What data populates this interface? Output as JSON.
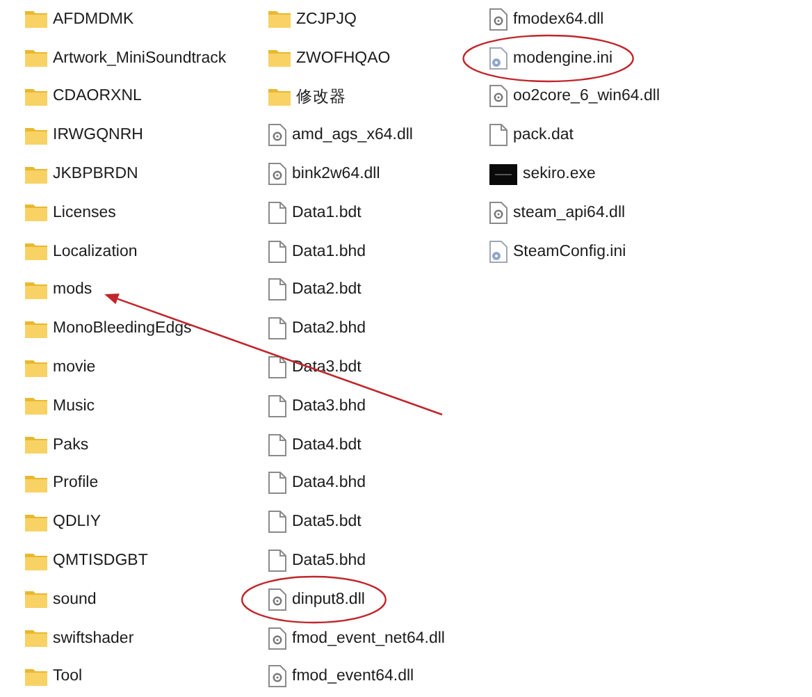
{
  "files": [
    {
      "name": "AFDMDMK",
      "kind": "folder",
      "circled": false,
      "arrowed": false
    },
    {
      "name": "Artwork_MiniSoundtrack",
      "kind": "folder",
      "circled": false,
      "arrowed": false
    },
    {
      "name": "CDAORXNL",
      "kind": "folder",
      "circled": false,
      "arrowed": false
    },
    {
      "name": "IRWGQNRH",
      "kind": "folder",
      "circled": false,
      "arrowed": false
    },
    {
      "name": "JKBPBRDN",
      "kind": "folder",
      "circled": false,
      "arrowed": false
    },
    {
      "name": "Licenses",
      "kind": "folder",
      "circled": false,
      "arrowed": false
    },
    {
      "name": "Localization",
      "kind": "folder",
      "circled": false,
      "arrowed": false
    },
    {
      "name": "mods",
      "kind": "folder",
      "circled": false,
      "arrowed": true
    },
    {
      "name": "MonoBleedingEdgs",
      "kind": "folder",
      "circled": false,
      "arrowed": false
    },
    {
      "name": "movie",
      "kind": "folder",
      "circled": false,
      "arrowed": false
    },
    {
      "name": "Music",
      "kind": "folder",
      "circled": false,
      "arrowed": false
    },
    {
      "name": "Paks",
      "kind": "folder",
      "circled": false,
      "arrowed": false
    },
    {
      "name": "Profile",
      "kind": "folder",
      "circled": false,
      "arrowed": false
    },
    {
      "name": "QDLIY",
      "kind": "folder",
      "circled": false,
      "arrowed": false
    },
    {
      "name": "QMTISDGBT",
      "kind": "folder",
      "circled": false,
      "arrowed": false
    },
    {
      "name": "sound",
      "kind": "folder",
      "circled": false,
      "arrowed": false
    },
    {
      "name": "swiftshader",
      "kind": "folder",
      "circled": false,
      "arrowed": false
    },
    {
      "name": "Tool",
      "kind": "folder",
      "circled": false,
      "arrowed": false
    },
    {
      "name": "ZCJPJQ",
      "kind": "folder",
      "circled": false,
      "arrowed": false
    },
    {
      "name": "ZWOFHQAO",
      "kind": "folder",
      "circled": false,
      "arrowed": false
    },
    {
      "name": "修改器",
      "kind": "folder",
      "circled": false,
      "arrowed": false
    },
    {
      "name": "amd_ags_x64.dll",
      "kind": "dll",
      "circled": false,
      "arrowed": false
    },
    {
      "name": "bink2w64.dll",
      "kind": "dll",
      "circled": false,
      "arrowed": false
    },
    {
      "name": "Data1.bdt",
      "kind": "file",
      "circled": false,
      "arrowed": false
    },
    {
      "name": "Data1.bhd",
      "kind": "file",
      "circled": false,
      "arrowed": false
    },
    {
      "name": "Data2.bdt",
      "kind": "file",
      "circled": false,
      "arrowed": false
    },
    {
      "name": "Data2.bhd",
      "kind": "file",
      "circled": false,
      "arrowed": false
    },
    {
      "name": "Data3.bdt",
      "kind": "file",
      "circled": false,
      "arrowed": false
    },
    {
      "name": "Data3.bhd",
      "kind": "file",
      "circled": false,
      "arrowed": false
    },
    {
      "name": "Data4.bdt",
      "kind": "file",
      "circled": false,
      "arrowed": false
    },
    {
      "name": "Data4.bhd",
      "kind": "file",
      "circled": false,
      "arrowed": false
    },
    {
      "name": "Data5.bdt",
      "kind": "file",
      "circled": false,
      "arrowed": false
    },
    {
      "name": "Data5.bhd",
      "kind": "file",
      "circled": false,
      "arrowed": false
    },
    {
      "name": "dinput8.dll",
      "kind": "dll",
      "circled": true,
      "arrowed": false
    },
    {
      "name": "fmod_event_net64.dll",
      "kind": "dll",
      "circled": false,
      "arrowed": false
    },
    {
      "name": "fmod_event64.dll",
      "kind": "dll",
      "circled": false,
      "arrowed": false
    },
    {
      "name": "fmodex64.dll",
      "kind": "dll",
      "circled": false,
      "arrowed": false
    },
    {
      "name": "modengine.ini",
      "kind": "ini",
      "circled": true,
      "arrowed": false
    },
    {
      "name": "oo2core_6_win64.dll",
      "kind": "dll",
      "circled": false,
      "arrowed": false
    },
    {
      "name": "pack.dat",
      "kind": "file",
      "circled": false,
      "arrowed": false
    },
    {
      "name": "sekiro.exe",
      "kind": "exe",
      "circled": false,
      "arrowed": false
    },
    {
      "name": "steam_api64.dll",
      "kind": "dll",
      "circled": false,
      "arrowed": false
    },
    {
      "name": "SteamConfig.ini",
      "kind": "ini",
      "circled": false,
      "arrowed": false
    }
  ]
}
